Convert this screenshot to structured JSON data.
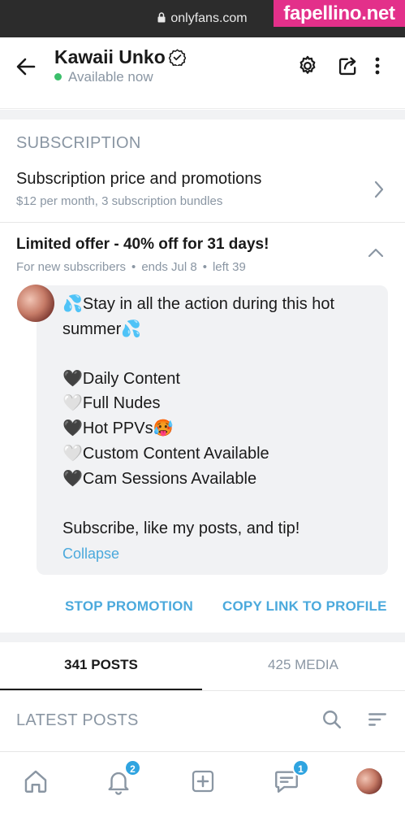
{
  "browser": {
    "url": "onlyfans.com",
    "watermark": "fapellino.net"
  },
  "profile": {
    "name": "Kawaii Unko",
    "status": "Available now"
  },
  "subscription": {
    "section_title": "SUBSCRIPTION",
    "title": "Subscription price and promotions",
    "subtitle": "$12 per month, 3 subscription bundles"
  },
  "offer": {
    "title": "Limited offer - 40% off for 31 days!",
    "audience": "For new subscribers",
    "ends": "ends Jul 8",
    "left": "left 39",
    "message_lines": [
      "💦Stay in all the action during this hot",
      "summer💦",
      "🖤Daily Content",
      "🤍Full Nudes",
      "🖤Hot PPVs🥵",
      "🤍Custom Content Available",
      "🖤Cam Sessions Available",
      "Subscribe, like my posts, and tip!"
    ],
    "collapse_label": "Collapse",
    "stop_label": "STOP PROMOTION",
    "copy_label": "COPY LINK TO PROFILE"
  },
  "tabs": [
    {
      "label": "341 POSTS",
      "active": true
    },
    {
      "label": "425 MEDIA",
      "active": false
    }
  ],
  "latest_posts": {
    "title": "LATEST POSTS"
  },
  "bottom_nav": {
    "items": [
      "home-icon",
      "bell-icon",
      "plus-square-icon",
      "chat-icon",
      "avatar"
    ],
    "notifications_badge": "2",
    "messages_badge": "1"
  },
  "colors": {
    "accent": "#4ba9dc",
    "badge": "#2fa4e0",
    "muted": "#8a96a3",
    "online": "#3bbf6b",
    "watermark": "#e3308a"
  }
}
